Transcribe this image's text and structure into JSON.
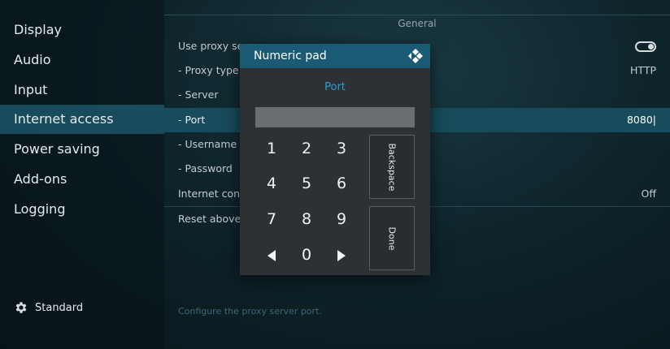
{
  "sidebar": {
    "items": [
      {
        "label": "Display"
      },
      {
        "label": "Audio"
      },
      {
        "label": "Input"
      },
      {
        "label": "Internet access"
      },
      {
        "label": "Power saving"
      },
      {
        "label": "Add-ons"
      },
      {
        "label": "Logging"
      }
    ],
    "active_index": 3,
    "settings_level": "Standard"
  },
  "main": {
    "section_title": "General",
    "rows": [
      {
        "label": "Use proxy server",
        "value": ""
      },
      {
        "label": "- Proxy type",
        "value": "HTTP"
      },
      {
        "label": "- Server",
        "value": ""
      },
      {
        "label": "- Port",
        "value": "8080|"
      },
      {
        "label": "- Username",
        "value": ""
      },
      {
        "label": "- Password",
        "value": ""
      },
      {
        "label": "Internet connection bandwidth limitation",
        "value": "Off"
      },
      {
        "label": "Reset above settings to default",
        "value": ""
      }
    ],
    "description": "Configure the proxy server port."
  },
  "dialog": {
    "title": "Numeric pad",
    "heading": "Port",
    "input_value": "",
    "keys": {
      "k1": "1",
      "k2": "2",
      "k3": "3",
      "k4": "4",
      "k5": "5",
      "k6": "6",
      "k7": "7",
      "k8": "8",
      "k9": "9",
      "k0": "0"
    },
    "backspace_label": "Backspace",
    "done_label": "Done"
  },
  "colors": {
    "accent": "#1b5a75",
    "highlight": "#184c5c",
    "heading": "#2c9fd0"
  },
  "icons": {
    "settings": "gear-icon",
    "brand": "kodi-logo-icon",
    "left": "arrow-left-icon",
    "right": "arrow-right-icon"
  }
}
